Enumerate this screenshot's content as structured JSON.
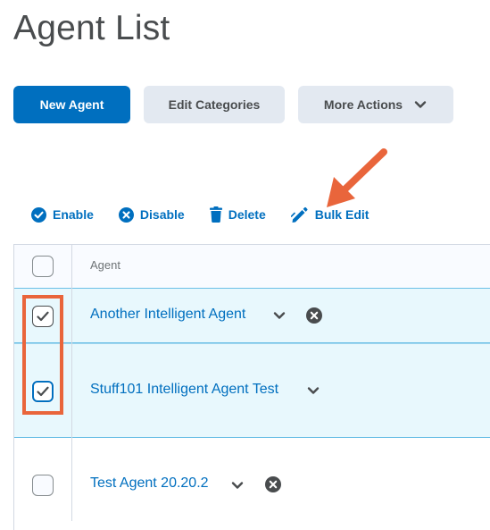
{
  "page": {
    "title": "Agent List"
  },
  "toolbar": {
    "new_agent": "New Agent",
    "edit_categories": "Edit Categories",
    "more_actions": "More Actions"
  },
  "actions": {
    "enable": "Enable",
    "disable": "Disable",
    "delete": "Delete",
    "bulk_edit": "Bulk Edit"
  },
  "table": {
    "column_agent": "Agent",
    "rows": [
      {
        "name": "Another Intelligent Agent",
        "checked": true,
        "selected": true,
        "has_disabled_icon": true
      },
      {
        "name": "Stuff101 Intelligent Agent Test",
        "checked": true,
        "selected": true,
        "has_disabled_icon": false
      },
      {
        "name": "Test Agent 20.20.2",
        "checked": false,
        "selected": false,
        "has_disabled_icon": true
      }
    ]
  },
  "icons": {
    "more_actions": "chevron-down-icon",
    "enable": "check-circle-icon",
    "disable": "x-circle-icon",
    "delete": "trash-icon",
    "bulk_edit": "pencil-edit-icon",
    "row_menu": "chevron-down-icon",
    "row_status": "x-circle-icon"
  },
  "colors": {
    "primary": "#006fbf",
    "selected_row": "#e8f8fd",
    "selected_border": "#6cc0e6",
    "annotation": "#e9653b",
    "secondary_button": "#e3e9f1"
  }
}
